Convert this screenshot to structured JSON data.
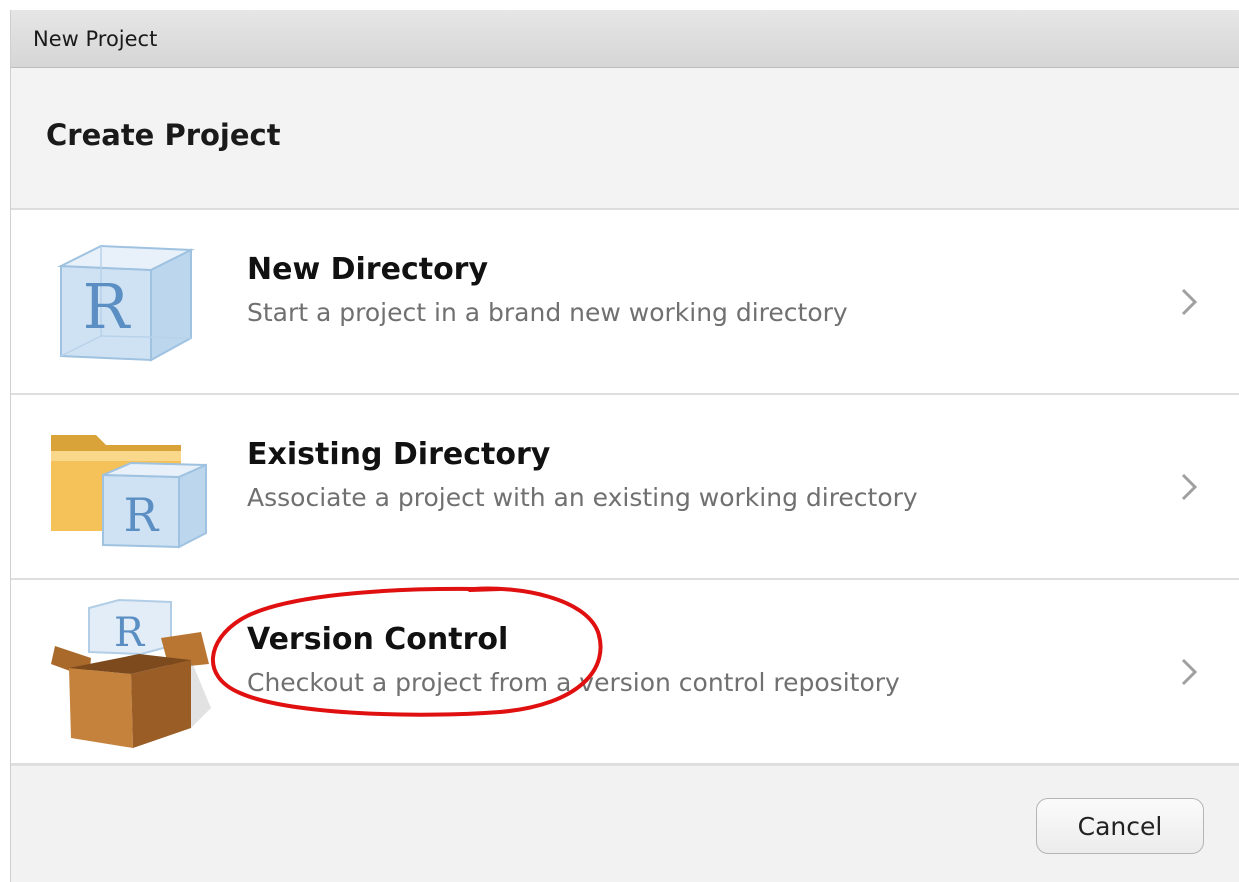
{
  "window": {
    "title": "New Project"
  },
  "header": {
    "title": "Create Project"
  },
  "options": [
    {
      "title": "New Directory",
      "description": "Start a project in a brand new working directory",
      "icon": "r-cube-icon"
    },
    {
      "title": "Existing Directory",
      "description": "Associate a project with an existing working directory",
      "icon": "folder-r-icon"
    },
    {
      "title": "Version Control",
      "description": "Checkout a project from a version control repository",
      "icon": "box-r-icon"
    }
  ],
  "footer": {
    "cancel_label": "Cancel"
  },
  "colors": {
    "annotation": "#e01010",
    "title_text": "#111111",
    "description_text": "#707070"
  }
}
